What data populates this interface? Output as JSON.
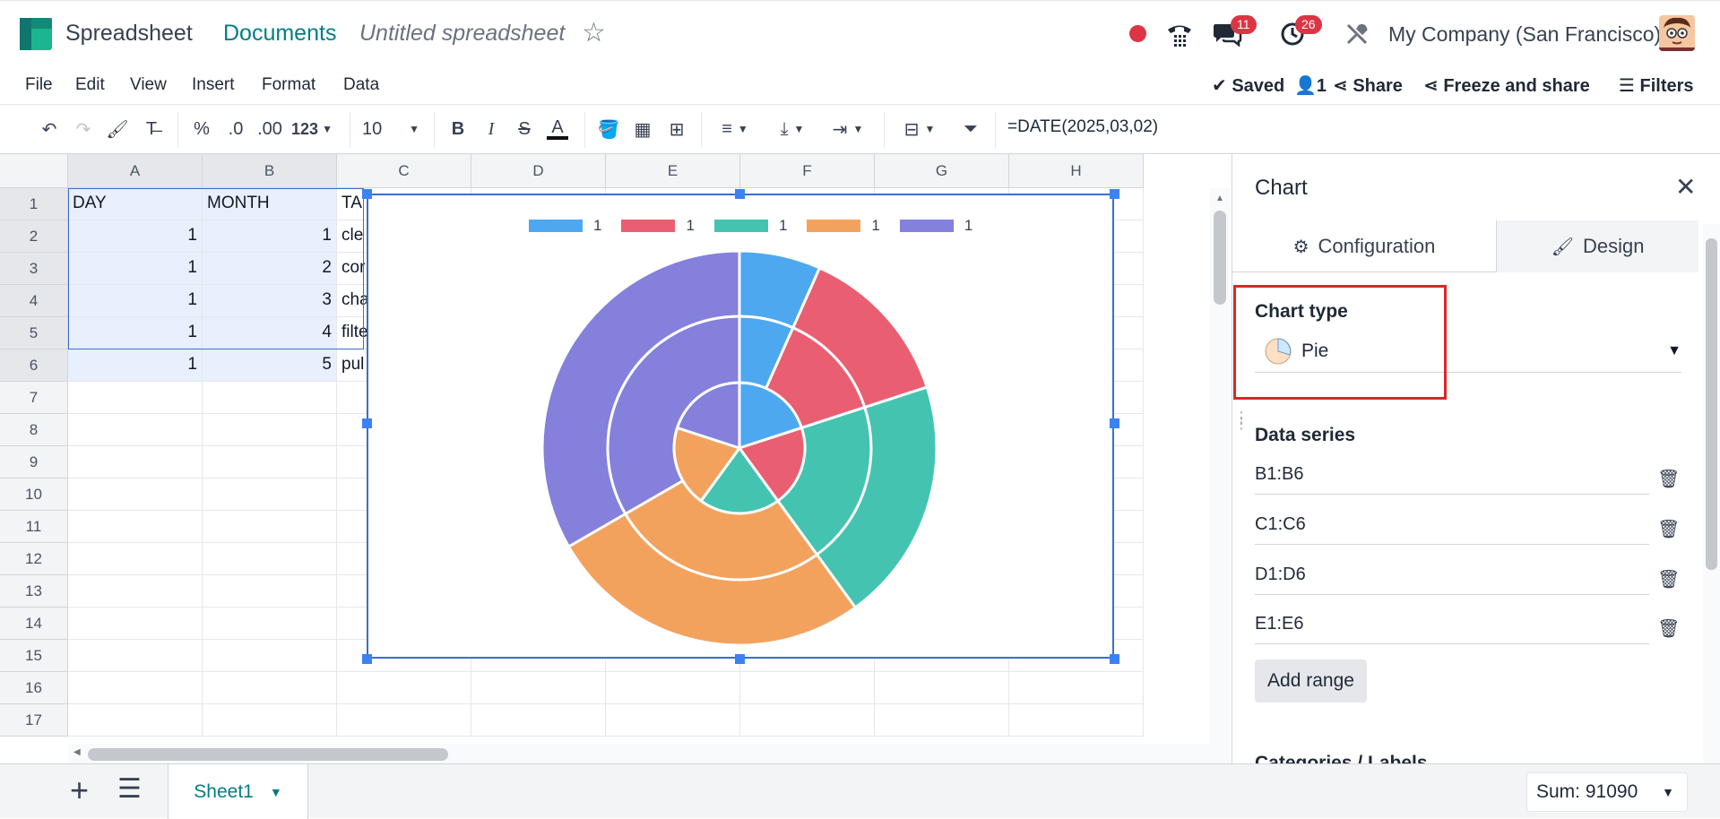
{
  "navbar": {
    "app_name": "Spreadsheet",
    "breadcrumb_documents": "Documents",
    "document_title": "Untitled spreadsheet",
    "messages_count": "11",
    "activities_count": "26",
    "company": "My Company (San Francisco)"
  },
  "menu": {
    "items": [
      "File",
      "Edit",
      "View",
      "Insert",
      "Format",
      "Data"
    ],
    "saved": "Saved",
    "users": "1",
    "share": "Share",
    "freeze_share": "Freeze and share",
    "filters": "Filters"
  },
  "toolbar": {
    "percent": "%",
    "dec_decrease": ".0",
    "dec_increase": ".00",
    "number_format": "123",
    "font_size": "10",
    "bold": "B",
    "italic": "I",
    "strike": "S",
    "text_color": "A",
    "formula": "=DATE(2025,03,02)"
  },
  "grid": {
    "columns": [
      "A",
      "B",
      "C",
      "D",
      "E",
      "F",
      "G",
      "H"
    ],
    "rows": [
      "1",
      "2",
      "3",
      "4",
      "5",
      "6",
      "7",
      "8",
      "9",
      "10",
      "11",
      "12",
      "13",
      "14",
      "15",
      "16",
      "17"
    ],
    "col_a": [
      "DAY",
      "1",
      "1",
      "1",
      "1",
      "1"
    ],
    "col_b": [
      "MONTH",
      "1",
      "2",
      "3",
      "4",
      "5"
    ],
    "col_c": [
      "TA",
      "cle",
      "cor",
      "cha",
      "filte",
      "pul"
    ]
  },
  "chart_data": {
    "type": "pie",
    "subtype": "multi-ring doughnut",
    "legend_position": "top",
    "colors": [
      "#4ea8f0",
      "#ea5e72",
      "#44c4b0",
      "#f3a25e",
      "#8480dc"
    ],
    "legend": [
      "1",
      "1",
      "1",
      "1",
      "1"
    ],
    "series": [
      {
        "name": "inner ring",
        "values": [
          1,
          1,
          1,
          1,
          1
        ],
        "note": "B1:B6"
      },
      {
        "name": "middle ring",
        "values": [
          1,
          2,
          3,
          4,
          5
        ]
      },
      {
        "name": "outer ring",
        "values": [
          1,
          2,
          3,
          4,
          5
        ]
      }
    ]
  },
  "bottom": {
    "sheet_name": "Sheet1",
    "sum_label": "Sum: 91090"
  },
  "panel": {
    "title": "Chart",
    "tab_config": "Configuration",
    "tab_design": "Design",
    "chart_type_label": "Chart type",
    "chart_type_value": "Pie",
    "data_series_label": "Data series",
    "ranges": [
      "B1:B6",
      "C1:C6",
      "D1:D6",
      "E1:E6"
    ],
    "add_range": "Add range",
    "categories_label": "Categories / Labels"
  }
}
